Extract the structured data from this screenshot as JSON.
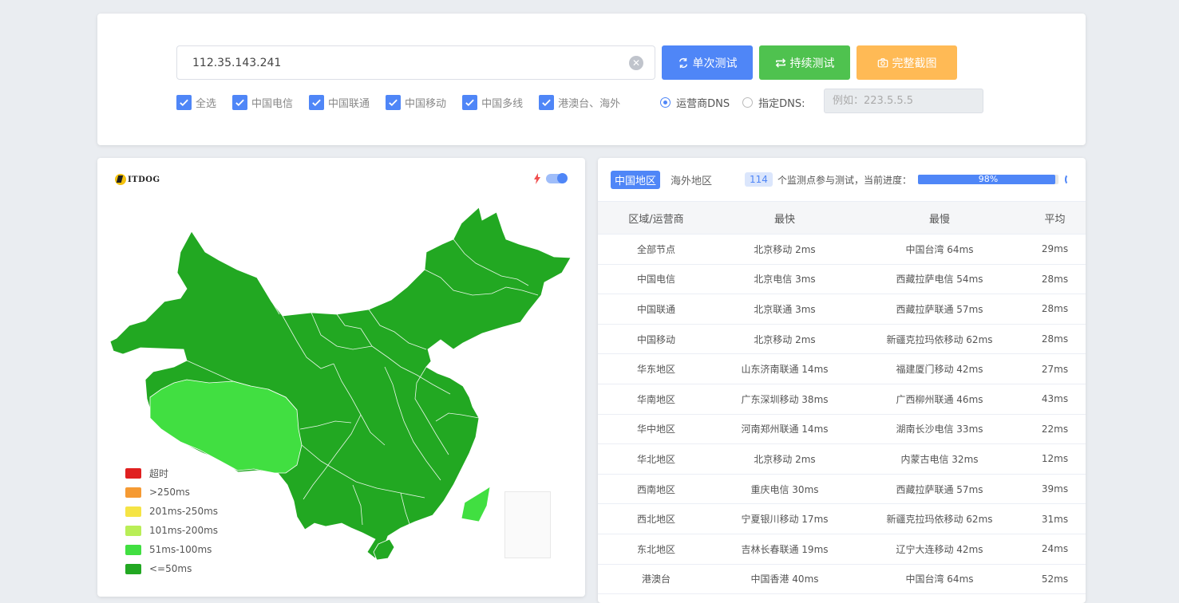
{
  "search": {
    "ip_value": "112.35.143.241",
    "clear_icon": "clear-circle-icon"
  },
  "buttons": {
    "single_test": "单次测试",
    "continuous_test": "持续测试",
    "full_screenshot": "完整截图",
    "single_icon": "refresh-icon",
    "continuous_icon": "loop-icon",
    "screenshot_icon": "camera-icon",
    "colors": {
      "single": "#4f86f7",
      "continuous": "#4fc24f",
      "screenshot": "#ffba55"
    }
  },
  "filters": {
    "checkboxes": [
      {
        "label": "全选",
        "checked": true
      },
      {
        "label": "中国电信",
        "checked": true
      },
      {
        "label": "中国联通",
        "checked": true
      },
      {
        "label": "中国移动",
        "checked": true
      },
      {
        "label": "中国多线",
        "checked": true
      },
      {
        "label": "港澳台、海外",
        "checked": true
      }
    ],
    "radio_isp_dns": "运营商DNS",
    "radio_custom_dns": "指定DNS:",
    "selected_radio": "运营商DNS",
    "dns_placeholder": "例如：223.5.5.5"
  },
  "map": {
    "logo_text": "ITDOG",
    "toggle_on": true,
    "legend": [
      {
        "label": "超时",
        "color": "#e02020"
      },
      {
        "label": ">250ms",
        "color": "#f59a33"
      },
      {
        "label": "201ms-250ms",
        "color": "#f5e445"
      },
      {
        "label": "101ms-200ms",
        "color": "#b9ee57"
      },
      {
        "label": "51ms-100ms",
        "color": "#41df41"
      },
      {
        "label": "<=50ms",
        "color": "#22a822"
      }
    ]
  },
  "stats": {
    "tab_china": "中国地区",
    "tab_overseas": "海外地区",
    "active_tab": "中国地区",
    "node_count": "114",
    "progress_label": "个监测点参与测试，当前进度：",
    "progress_percent": 98,
    "progress_text": "98%",
    "columns": [
      "区域/运营商",
      "最快",
      "最慢",
      "平均"
    ],
    "rows": [
      [
        "全部节点",
        "北京移动 2ms",
        "中国台湾 64ms",
        "29ms"
      ],
      [
        "中国电信",
        "北京电信 3ms",
        "西藏拉萨电信 54ms",
        "28ms"
      ],
      [
        "中国联通",
        "北京联通 3ms",
        "西藏拉萨联通 57ms",
        "28ms"
      ],
      [
        "中国移动",
        "北京移动 2ms",
        "新疆克拉玛依移动 62ms",
        "28ms"
      ],
      [
        "华东地区",
        "山东济南联通 14ms",
        "福建厦门移动 42ms",
        "27ms"
      ],
      [
        "华南地区",
        "广东深圳移动 38ms",
        "广西柳州联通 46ms",
        "43ms"
      ],
      [
        "华中地区",
        "河南郑州联通 14ms",
        "湖南长沙电信 33ms",
        "22ms"
      ],
      [
        "华北地区",
        "北京移动 2ms",
        "内蒙古电信 32ms",
        "12ms"
      ],
      [
        "西南地区",
        "重庆电信 30ms",
        "西藏拉萨联通 57ms",
        "39ms"
      ],
      [
        "西北地区",
        "宁夏银川移动 17ms",
        "新疆克拉玛依移动 62ms",
        "31ms"
      ],
      [
        "东北地区",
        "吉林长春联通 19ms",
        "辽宁大连移动 42ms",
        "24ms"
      ],
      [
        "港澳台",
        "中国香港 40ms",
        "中国台湾 64ms",
        "52ms"
      ]
    ]
  }
}
